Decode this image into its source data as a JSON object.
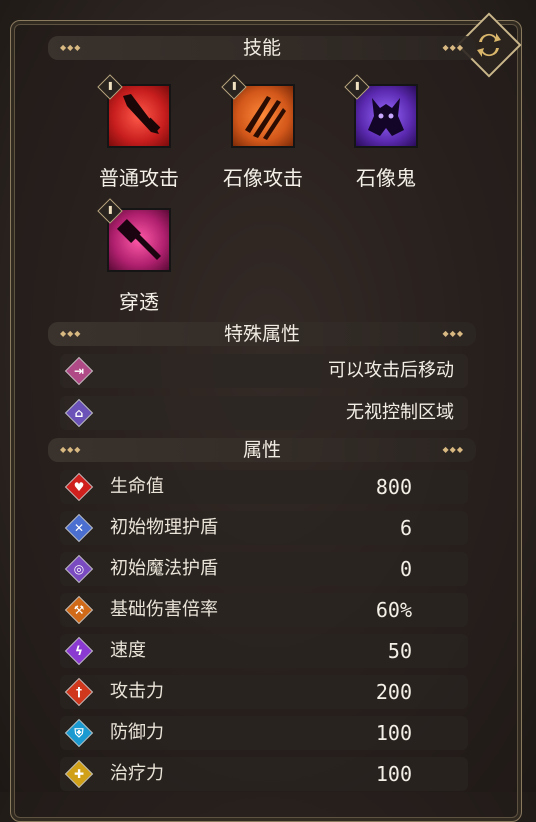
{
  "skills_section": {
    "title": "技能"
  },
  "skills": [
    {
      "label": "普通攻击",
      "icon": "sword-icon",
      "color": "#c81e1e"
    },
    {
      "label": "石像攻击",
      "icon": "claw-icon",
      "color": "#d2571a"
    },
    {
      "label": "石像鬼",
      "icon": "gargoyle-icon",
      "color": "#5b2ab0"
    },
    {
      "label": "穿透",
      "icon": "hammer-icon",
      "color": "#b0206e"
    }
  ],
  "special_section": {
    "title": "特殊属性"
  },
  "special": [
    {
      "text": "可以攻击后移动",
      "icon": "move-after-attack-icon",
      "color": "#b04a86"
    },
    {
      "text": "无视控制区域",
      "icon": "ignore-zoc-icon",
      "color": "#6a52b8"
    }
  ],
  "attr_section": {
    "title": "属性"
  },
  "attributes": [
    {
      "name": "生命值",
      "value": "800",
      "icon": "heart-icon",
      "color": "#d0201e"
    },
    {
      "name": "初始物理护盾",
      "value": "6",
      "icon": "physical-shield-icon",
      "color": "#4a6fd0"
    },
    {
      "name": "初始魔法护盾",
      "value": "0",
      "icon": "magic-shield-icon",
      "color": "#7a4ac0"
    },
    {
      "name": "基础伤害倍率",
      "value": "60%",
      "icon": "damage-multiplier-icon",
      "color": "#d06a18"
    },
    {
      "name": "速度",
      "value": "50",
      "icon": "speed-icon",
      "color": "#8a3ad0"
    },
    {
      "name": "攻击力",
      "value": "200",
      "icon": "attack-icon",
      "color": "#d0381e"
    },
    {
      "name": "防御力",
      "value": "100",
      "icon": "defense-icon",
      "color": "#1a9ad0"
    },
    {
      "name": "治疗力",
      "value": "100",
      "icon": "heal-icon",
      "color": "#d0a018"
    }
  ]
}
